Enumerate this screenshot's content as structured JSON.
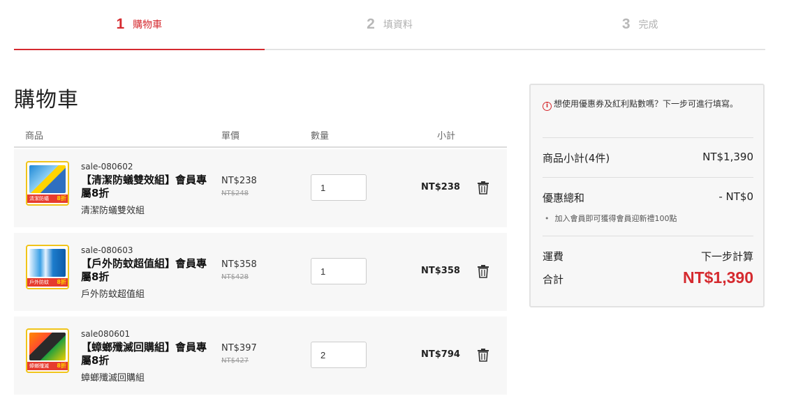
{
  "steps": [
    {
      "num": "1",
      "label": "購物車"
    },
    {
      "num": "2",
      "label": "填資料"
    },
    {
      "num": "3",
      "label": "完成"
    }
  ],
  "page_title": "購物車",
  "table_headers": {
    "product": "商品",
    "price": "單價",
    "qty": "數量",
    "subtotal": "小計"
  },
  "items": [
    {
      "sku": "sale-080602",
      "name": "【清潔防蟻雙效組】會員專屬8折",
      "variant": "清潔防蟻雙效組",
      "price": "NT$238",
      "old_price": "NT$248",
      "qty": "1",
      "subtotal": "NT$238",
      "thumb_band": "清潔防蟻",
      "thumb_badge": "8折"
    },
    {
      "sku": "sale-080603",
      "name": "【戶外防蚊超值組】會員專屬8折",
      "variant": "戶外防蚊超值組",
      "price": "NT$358",
      "old_price": "NT$428",
      "qty": "1",
      "subtotal": "NT$358",
      "thumb_band": "戶外防蚊",
      "thumb_badge": "8折"
    },
    {
      "sku": "sale080601",
      "name": "【蟑螂殲滅回購組】會員專屬8折",
      "variant": "蟑螂殲滅回購組",
      "price": "NT$397",
      "old_price": "NT$427",
      "qty": "2",
      "subtotal": "NT$794",
      "thumb_band": "蟑螂殲滅",
      "thumb_badge": "8折"
    }
  ],
  "summary": {
    "notice": "想使用優惠券及紅利點數嗎？下一步可進行填寫。",
    "items_label": "商品小計(4件)",
    "items_value": "NT$1,390",
    "discount_label": "優惠總和",
    "discount_value": "- NT$0",
    "discount_note": "加入會員即可獲得會員迎新禮100點",
    "shipping_label": "運費",
    "shipping_value": "下一步計算",
    "total_label": "合計",
    "total_value": "NT$1,390"
  },
  "colors": {
    "accent": "#d52a2f",
    "row_bg": "#f7f7f7",
    "thumb_border": "#f0c419"
  },
  "icons": {
    "trash": "trash-icon",
    "info": "info-icon"
  }
}
